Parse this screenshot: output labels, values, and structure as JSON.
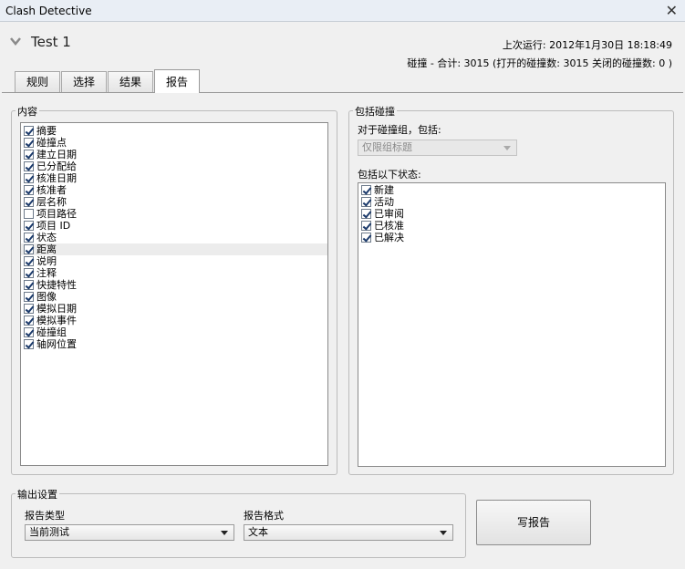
{
  "window": {
    "title": "Clash Detective"
  },
  "header": {
    "test_name": "Test 1",
    "last_run_label": "上次运行:",
    "last_run_value": "2012年1月30日 18:18:49",
    "summary": "碰撞 -  合计:  3015  (打开的碰撞数:  3015  关闭的碰撞数:  0 )"
  },
  "tabs": [
    "规则",
    "选择",
    "结果",
    "报告"
  ],
  "active_tab": "报告",
  "contents": {
    "title": "内容",
    "items": [
      {
        "label": "摘要",
        "checked": true
      },
      {
        "label": "碰撞点",
        "checked": true
      },
      {
        "label": "建立日期",
        "checked": true
      },
      {
        "label": "已分配给",
        "checked": true
      },
      {
        "label": "核准日期",
        "checked": true
      },
      {
        "label": "核准者",
        "checked": true
      },
      {
        "label": "层名称",
        "checked": true
      },
      {
        "label": "项目路径",
        "checked": false
      },
      {
        "label": "项目 ID",
        "checked": true
      },
      {
        "label": "状态",
        "checked": true
      },
      {
        "label": "距离",
        "checked": true
      },
      {
        "label": "说明",
        "checked": true
      },
      {
        "label": "注释",
        "checked": true
      },
      {
        "label": "快捷特性",
        "checked": true
      },
      {
        "label": "图像",
        "checked": true
      },
      {
        "label": "模拟日期",
        "checked": true
      },
      {
        "label": "模拟事件",
        "checked": true
      },
      {
        "label": "碰撞组",
        "checked": true
      },
      {
        "label": "轴网位置",
        "checked": true
      }
    ]
  },
  "include": {
    "title": "包括碰撞",
    "group_label": "对于碰撞组，包括:",
    "group_select": "仅限组标题",
    "status_label": "包括以下状态:",
    "statuses": [
      {
        "label": "新建",
        "checked": true
      },
      {
        "label": "活动",
        "checked": true
      },
      {
        "label": "已审阅",
        "checked": true
      },
      {
        "label": "已核准",
        "checked": true
      },
      {
        "label": "已解决",
        "checked": true
      }
    ]
  },
  "output": {
    "title": "输出设置",
    "report_type_label": "报告类型",
    "report_type_value": "当前测试",
    "report_format_label": "报告格式",
    "report_format_value": "文本"
  },
  "write_button": "写报告"
}
